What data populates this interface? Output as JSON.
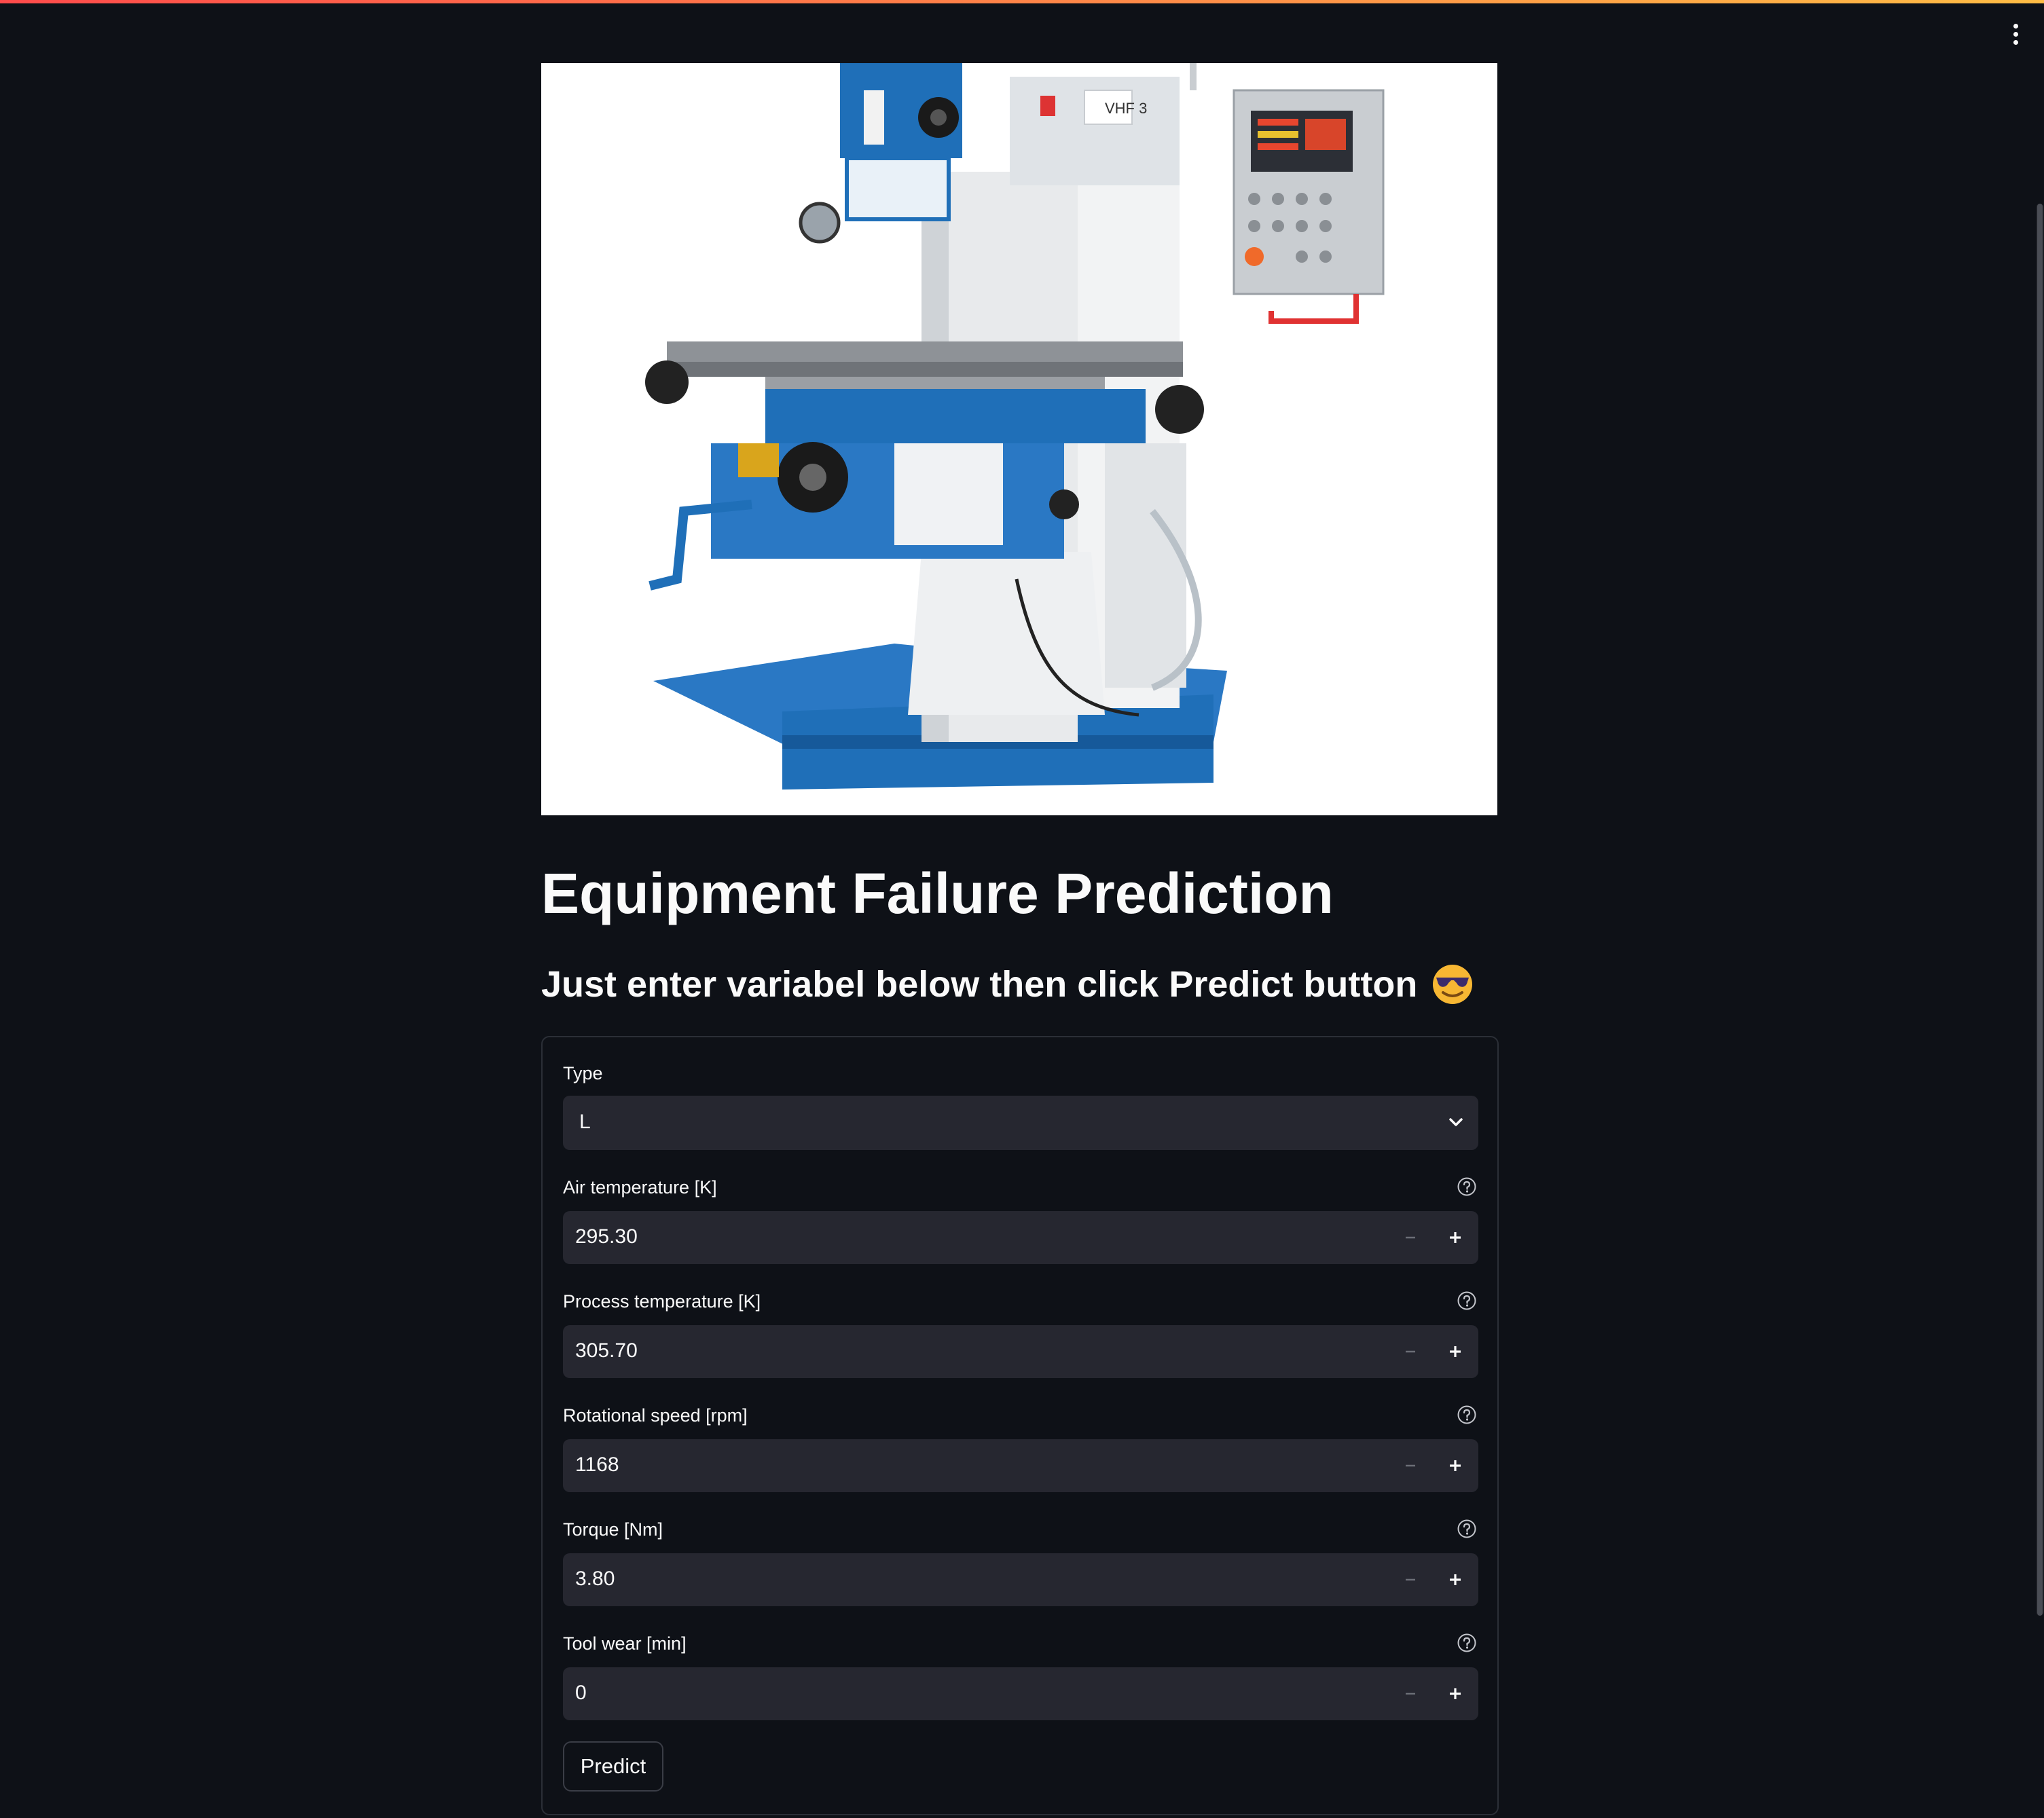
{
  "app": {
    "title": "Equipment Failure Prediction",
    "subtitle": "Just enter variabel below then click Predict button",
    "subtitle_emoji_icon": "smiling-face-with-sunglasses-icon",
    "menu_icon": "vertical-ellipsis-icon",
    "hero_image": "milling-machine-photo",
    "hero_image_text": "VHF 3"
  },
  "form": {
    "type_field": {
      "label": "Type",
      "value": "L"
    },
    "fields": [
      {
        "label": "Air temperature [K]",
        "value": "295.30"
      },
      {
        "label": "Process temperature [K]",
        "value": "305.70"
      },
      {
        "label": "Rotational speed [rpm]",
        "value": "1168"
      },
      {
        "label": "Torque [Nm]",
        "value": "3.80"
      },
      {
        "label": "Tool wear [min]",
        "value": "0"
      }
    ],
    "submit_label": "Predict"
  },
  "colors": {
    "background": "#0e1117",
    "input_bg": "#262730",
    "text": "#fafafa",
    "accent_gradient_start": "#ff4b4b",
    "accent_gradient_end": "#ffbd45",
    "machine_blue": "#1f6fb8"
  }
}
